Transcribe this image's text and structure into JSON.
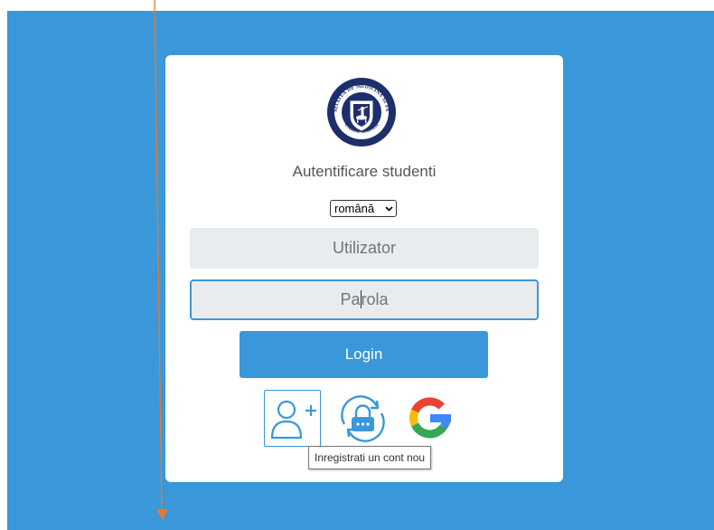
{
  "page": {
    "title": "Autentificare studenti",
    "language": {
      "selected": "română"
    },
    "username": {
      "placeholder": "Utilizator"
    },
    "password": {
      "placeholder_before_caret": "Pa",
      "placeholder_after_caret": "rola"
    },
    "login_button": {
      "label": "Login"
    },
    "tooltip": {
      "text": "Inregistrati un cont nou"
    },
    "logo": {
      "text_top": "UNIVERSITATEA DE MEDICINA SI FARMACIE",
      "text_bottom": "CAROL DAVILA"
    }
  },
  "colors": {
    "accent": "#3a97d9",
    "background": "#3a97d9",
    "card": "#ffffff",
    "field": "#e9ecef",
    "arrow": "#e8792d"
  },
  "icons": [
    "university-seal-icon",
    "add-user-icon",
    "password-reset-icon",
    "google-icon",
    "chevron-down-icon"
  ]
}
